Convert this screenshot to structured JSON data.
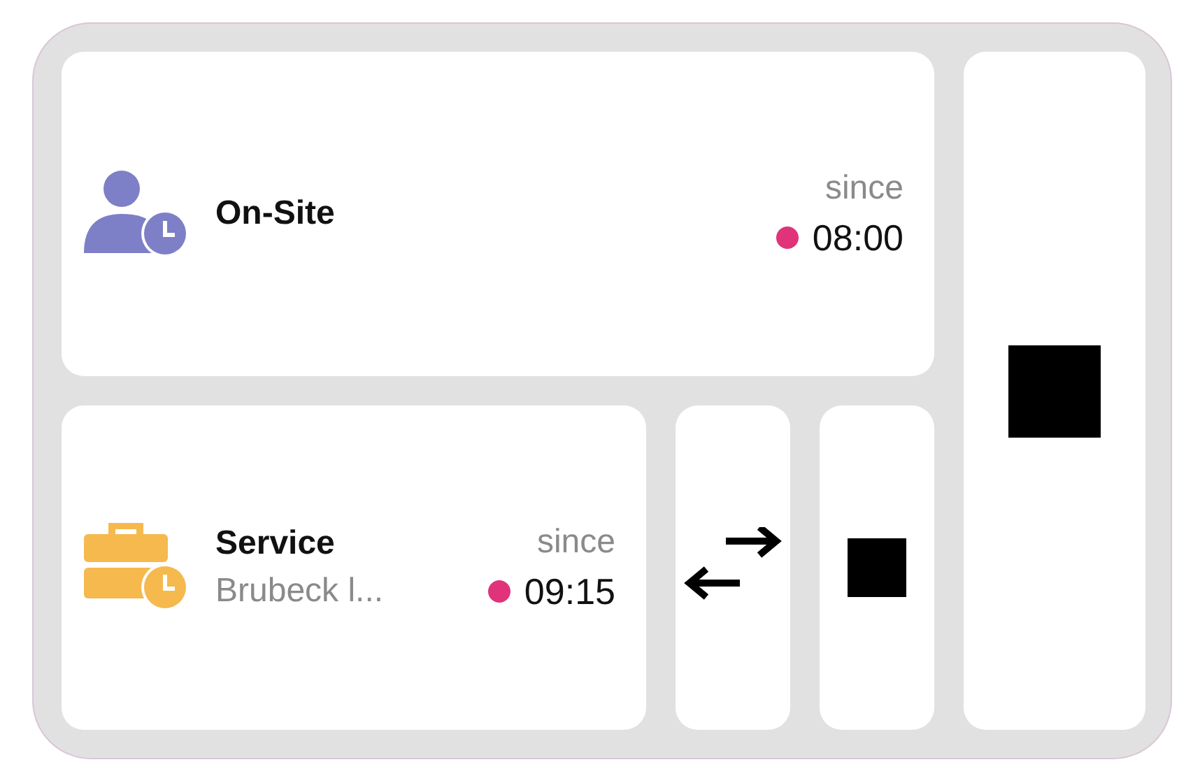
{
  "status_cards": [
    {
      "kind": "presence",
      "title": "On-Site",
      "since_label": "since",
      "time": "08:00",
      "color": "#e0337a"
    },
    {
      "kind": "service",
      "title": "Service",
      "subtitle": "Brubeck l...",
      "since_label": "since",
      "time": "09:15",
      "color": "#e0337a"
    }
  ],
  "actions": [
    {
      "kind": "swap"
    },
    {
      "kind": "stop"
    }
  ],
  "side_action": {
    "kind": "stop"
  }
}
